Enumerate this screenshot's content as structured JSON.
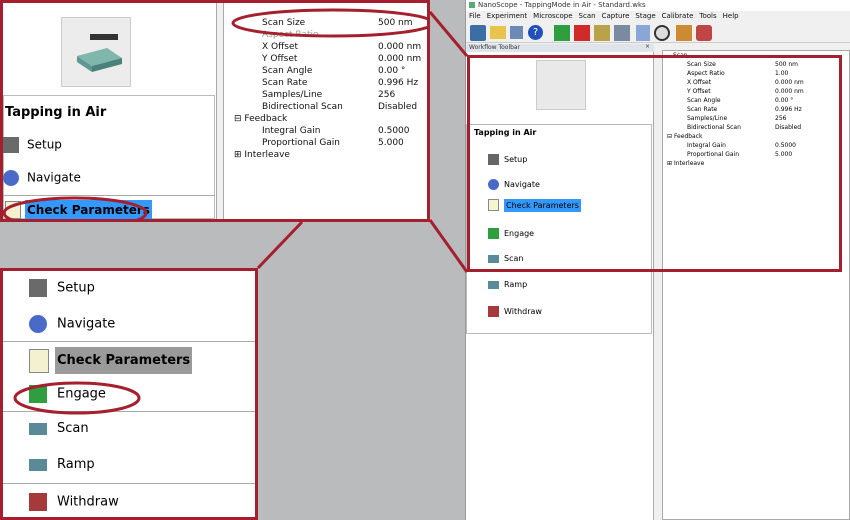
{
  "app": {
    "title": "NanoScope - TappingMode in Air - Standard.wks",
    "menu": [
      "File",
      "Experiment",
      "Microscope",
      "Scan",
      "Capture",
      "Stage",
      "Calibrate",
      "Tools",
      "Help"
    ],
    "toolbar_label": "Workflow Toolbar"
  },
  "workflow": {
    "header": "Tapping in Air",
    "items": [
      "Setup",
      "Navigate",
      "Check Parameters",
      "Engage",
      "Scan",
      "Ramp",
      "Withdraw"
    ]
  },
  "params": {
    "rows": [
      {
        "label": "Scan Size",
        "value": "500 nm"
      },
      {
        "label": "Aspect Ratio",
        "value": "1.00"
      },
      {
        "label": "X Offset",
        "value": "0.000 nm"
      },
      {
        "label": "Y Offset",
        "value": "0.000 nm"
      },
      {
        "label": "Scan Angle",
        "value": "0.00 °"
      },
      {
        "label": "Scan Rate",
        "value": "0.996 Hz"
      },
      {
        "label": "Samples/Line",
        "value": "256"
      },
      {
        "label": "Bidirectional Scan",
        "value": "Disabled"
      }
    ],
    "feedback_group": "Feedback",
    "feedback_rows": [
      {
        "label": "Integral Gain",
        "value": "0.5000"
      },
      {
        "label": "Proportional Gain",
        "value": "5.000"
      }
    ],
    "interleave_group": "Interleave",
    "scan_group": "Scan"
  }
}
